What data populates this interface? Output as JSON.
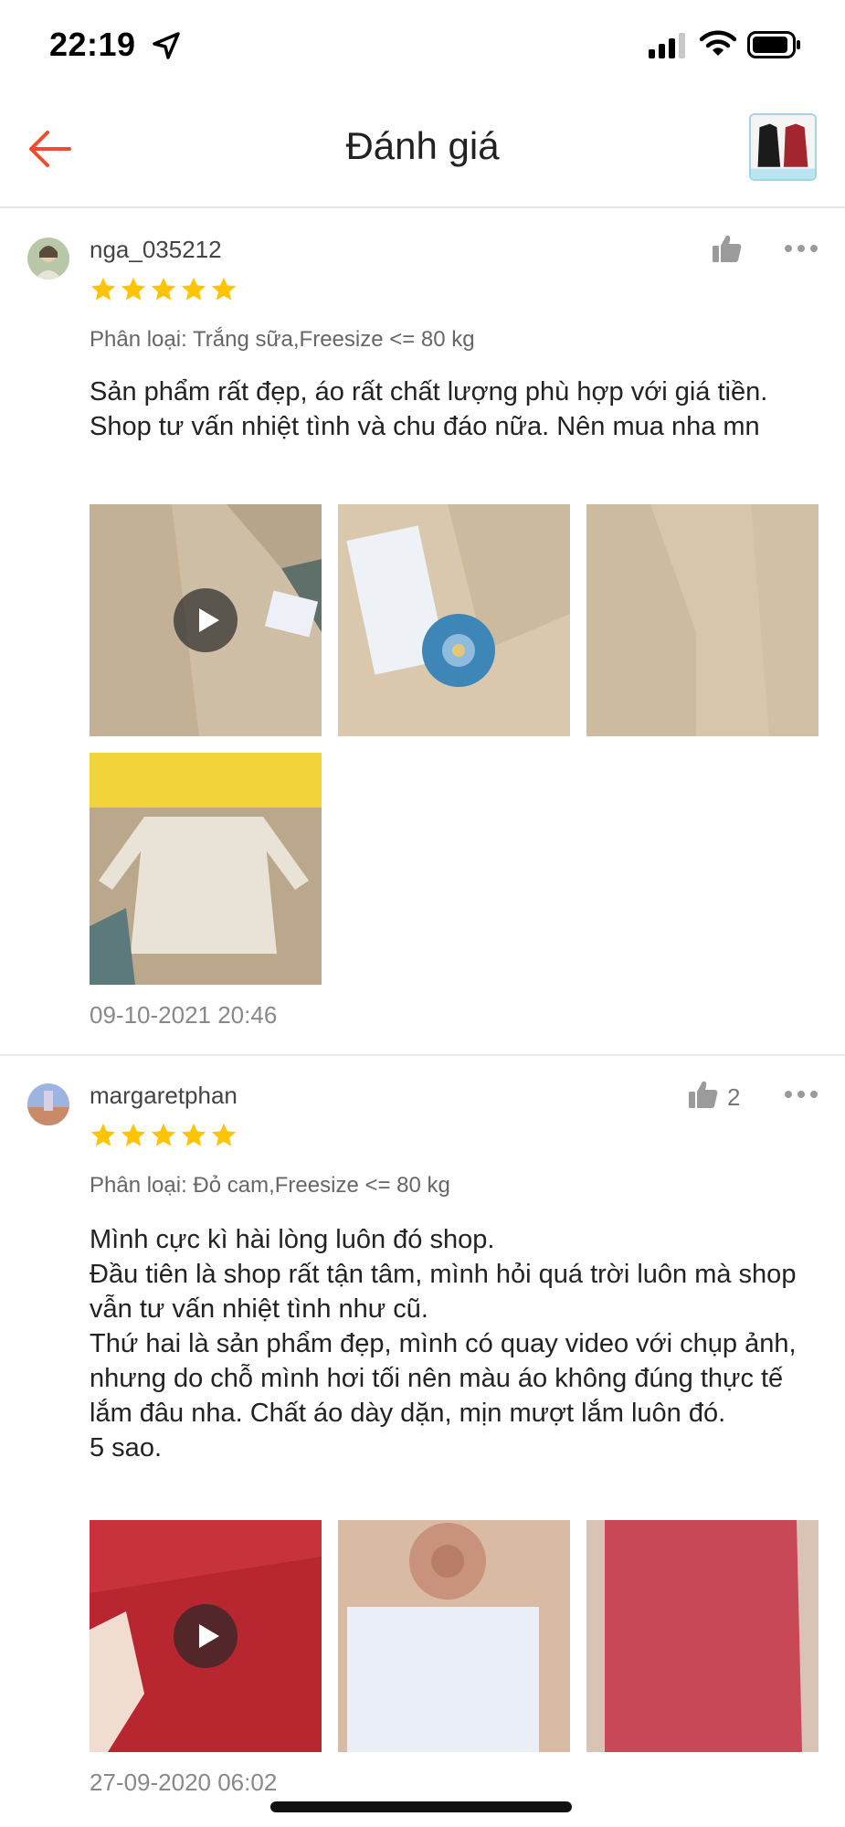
{
  "status_bar": {
    "time": "22:19"
  },
  "header": {
    "title": "Đánh giá"
  },
  "reviews": [
    {
      "username": "nga_035212",
      "rating": 5,
      "variant": "Phân loại: Trắng sữa,Freesize <= 80 kg",
      "comment": "Sản phẩm rất đẹp, áo rất chất lượng phù hợp với giá tiền. Shop tư vấn nhiệt tình và chu đáo nữa. Nên mua nha mn",
      "likes": "",
      "timestamp": "09-10-2021 20:46",
      "photos": 4
    },
    {
      "username": "margaretphan",
      "rating": 5,
      "variant": "Phân loại: Đỏ cam,Freesize <= 80 kg",
      "comment": "Mình cực kì hài lòng luôn đó shop.\nĐầu tiên là shop rất tận tâm, mình hỏi quá trời luôn mà shop vẫn tư vấn nhiệt tình như cũ.\nThứ hai là sản phẩm đẹp, mình có quay video với chụp ảnh, nhưng do chỗ mình hơi tối nên màu áo không đúng thực tế lắm đâu nha. Chất áo dày dặn, mịn mượt lắm luôn đó.\n5 sao.",
      "likes": "2",
      "timestamp": "27-09-2020 06:02",
      "photos": 3
    }
  ],
  "colors": {
    "accent": "#ee4d2d",
    "star": "#ffc400",
    "divider": "#ececec"
  }
}
